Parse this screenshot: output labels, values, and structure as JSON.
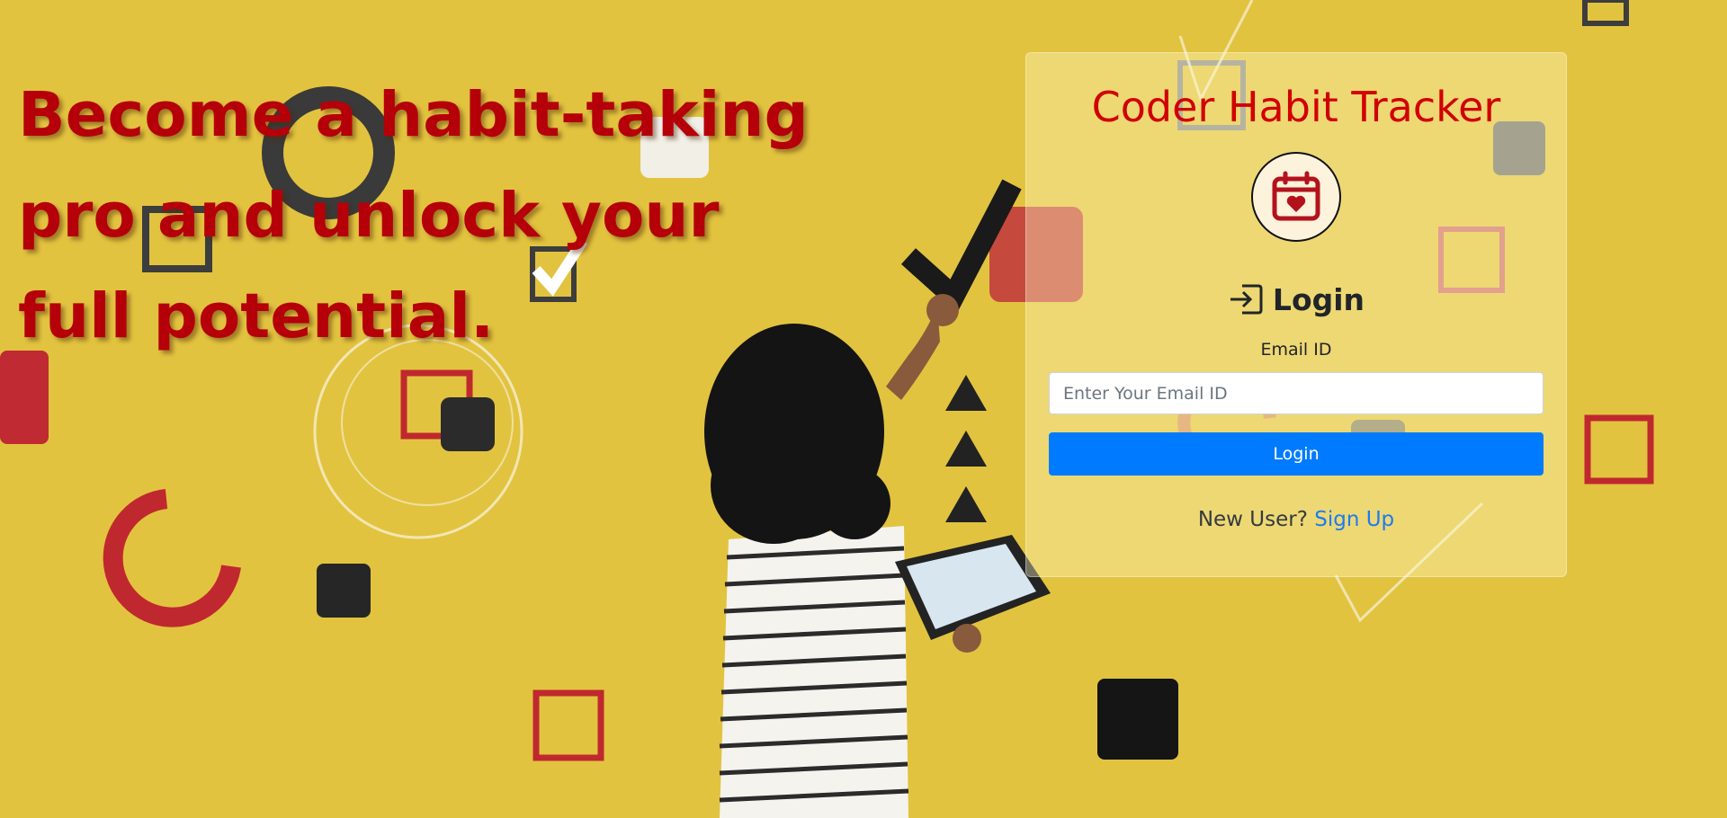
{
  "hero": {
    "headline": "Become a habit-taking pro and unlock your full potential."
  },
  "card": {
    "title": "Coder Habit Tracker",
    "logo_icon": "calendar-heart-icon",
    "login_heading": "Login",
    "login_heading_icon": "login-arrow-icon",
    "email_label": "Email ID",
    "email_placeholder": "Enter Your Email ID",
    "email_value": "",
    "login_button": "Login",
    "signup_prompt": "New User?",
    "signup_link": "Sign Up"
  },
  "colors": {
    "background": "#e2c33f",
    "headline": "#b5000a",
    "title": "#d10000",
    "button": "#007bff",
    "link": "#1e7bf0"
  }
}
